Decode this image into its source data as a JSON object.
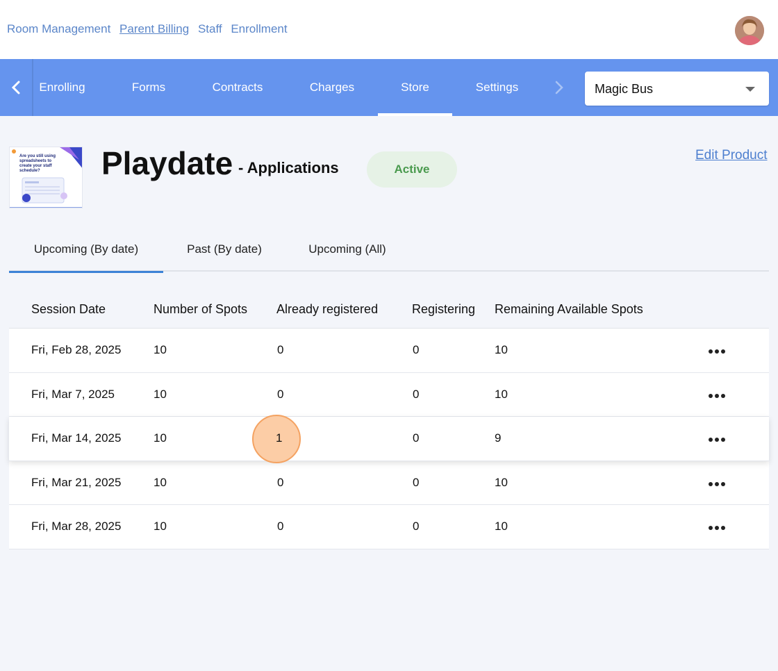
{
  "top_nav": {
    "links": [
      "Room Management",
      "Parent Billing",
      "Staff",
      "Enrollment"
    ]
  },
  "main_nav": {
    "tabs": [
      "Enrolling",
      "Forms",
      "Contracts",
      "Charges",
      "Store",
      "Settings"
    ],
    "active_tab": "Store",
    "center_select": {
      "value": "Magic Bus"
    }
  },
  "product": {
    "title": "Playdate",
    "subtitle": "- Applications",
    "status": "Active",
    "edit_label": "Edit Product",
    "thumbnail_text": "Are you still using spreadsheets to create your staff schedule?"
  },
  "sub_tabs": [
    "Upcoming (By date)",
    "Past (By date)",
    "Upcoming (All)"
  ],
  "table": {
    "headers": [
      "Session Date",
      "Number of Spots",
      "Already registered",
      "Registering",
      "Remaining Available Spots"
    ],
    "rows": [
      [
        "Fri, Feb 28, 2025",
        "10",
        "0",
        "0",
        "10"
      ],
      [
        "Fri, Mar 7, 2025",
        "10",
        "0",
        "0",
        "10"
      ],
      [
        "Fri, Mar 14, 2025",
        "10",
        "1",
        "0",
        "9"
      ],
      [
        "Fri, Mar 21, 2025",
        "10",
        "0",
        "0",
        "10"
      ],
      [
        "Fri, Mar 28, 2025",
        "10",
        "0",
        "0",
        "10"
      ]
    ]
  },
  "colors": {
    "nav_bg": "#6594ee",
    "link": "#5b86c9",
    "active_badge_bg": "#e6f2e6",
    "active_badge_text": "#4a9a4e",
    "click_marker": "#f4a261"
  }
}
